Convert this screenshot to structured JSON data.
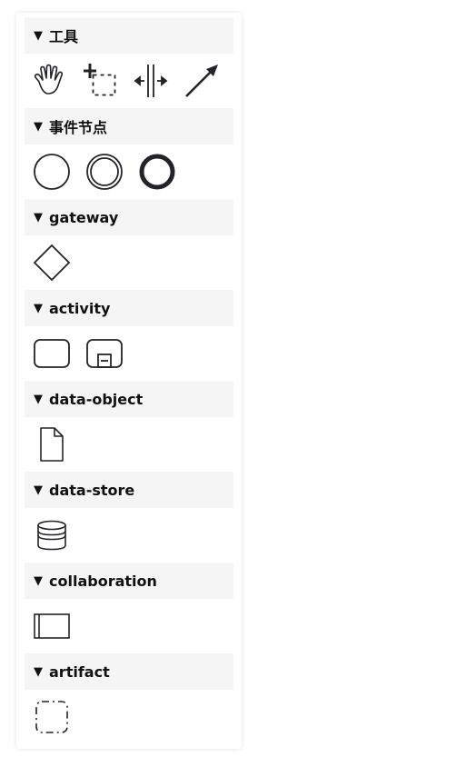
{
  "palette": {
    "groups": [
      {
        "label": "工具",
        "items": [
          {
            "name": "hand-tool",
            "icon": "hand-icon"
          },
          {
            "name": "lasso-tool",
            "icon": "lasso-icon"
          },
          {
            "name": "space-tool",
            "icon": "space-icon"
          },
          {
            "name": "connect-tool",
            "icon": "arrow-icon"
          }
        ]
      },
      {
        "label": "事件节点",
        "items": [
          {
            "name": "start-event",
            "icon": "circle-thin-icon"
          },
          {
            "name": "intermediate-event",
            "icon": "circle-double-icon"
          },
          {
            "name": "end-event",
            "icon": "circle-thick-icon"
          }
        ]
      },
      {
        "label": "gateway",
        "items": [
          {
            "name": "exclusive-gateway",
            "icon": "diamond-icon"
          }
        ]
      },
      {
        "label": "activity",
        "items": [
          {
            "name": "task",
            "icon": "rounded-rect-icon"
          },
          {
            "name": "subprocess",
            "icon": "subprocess-icon"
          }
        ]
      },
      {
        "label": "data-object",
        "items": [
          {
            "name": "data-object",
            "icon": "document-icon"
          }
        ]
      },
      {
        "label": "data-store",
        "items": [
          {
            "name": "data-store",
            "icon": "database-icon"
          }
        ]
      },
      {
        "label": "collaboration",
        "items": [
          {
            "name": "participant",
            "icon": "pool-icon"
          }
        ]
      },
      {
        "label": "artifact",
        "items": [
          {
            "name": "group",
            "icon": "dashed-group-icon"
          }
        ]
      }
    ],
    "caret": "▼",
    "stroke_color": "#22242a",
    "header_bg": "#f5f5f5"
  }
}
